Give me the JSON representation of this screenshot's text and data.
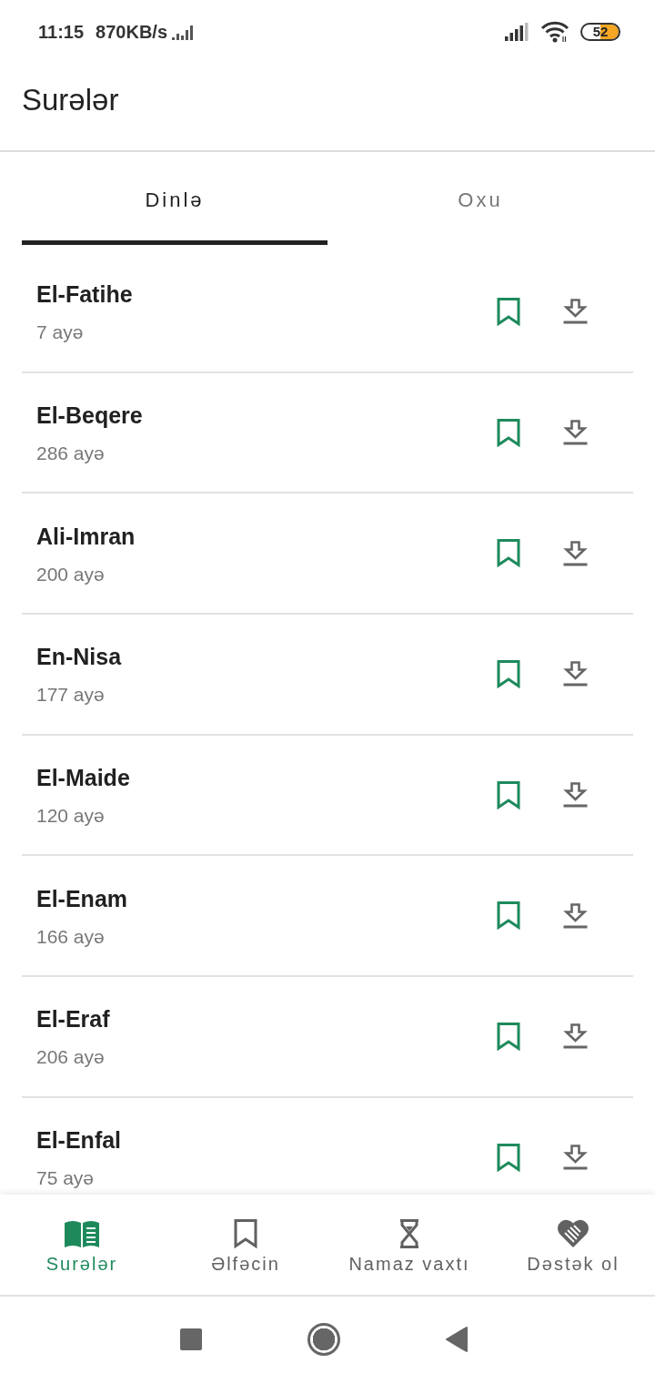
{
  "status_bar": {
    "time": "11:15",
    "network_speed": "870KB/s",
    "battery": "52"
  },
  "app_bar": {
    "title": "Surələr"
  },
  "tabs": [
    {
      "label": "Dinlə",
      "selected": true
    },
    {
      "label": "Oxu",
      "selected": false
    }
  ],
  "surahs": [
    {
      "name": "El-Fatihe",
      "verses": "7 ayə"
    },
    {
      "name": "El-Beqere",
      "verses": "286 ayə"
    },
    {
      "name": "Ali-Imran",
      "verses": "200 ayə"
    },
    {
      "name": "En-Nisa",
      "verses": "177 ayə"
    },
    {
      "name": "El-Maide",
      "verses": "120 ayə"
    },
    {
      "name": "El-Enam",
      "verses": "166 ayə"
    },
    {
      "name": "El-Eraf",
      "verses": "206 ayə"
    },
    {
      "name": "El-Enfal",
      "verses": "75 ayə"
    }
  ],
  "bottom_nav": [
    {
      "label": "Surələr",
      "selected": true
    },
    {
      "label": "Əlfəcin",
      "selected": false
    },
    {
      "label": "Namaz vaxtı",
      "selected": false
    },
    {
      "label": "Dəstək ol",
      "selected": false
    }
  ]
}
